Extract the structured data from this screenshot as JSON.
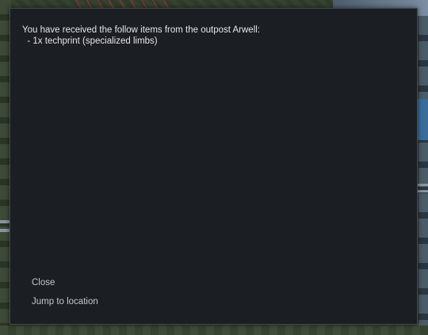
{
  "dialog": {
    "message_lines": [
      "You have received the follow items from the outpost Arwell:",
      "  - 1x techprint (specialized limbs)"
    ],
    "options": {
      "close": "Close",
      "jump_to_location": "Jump to location"
    }
  }
}
